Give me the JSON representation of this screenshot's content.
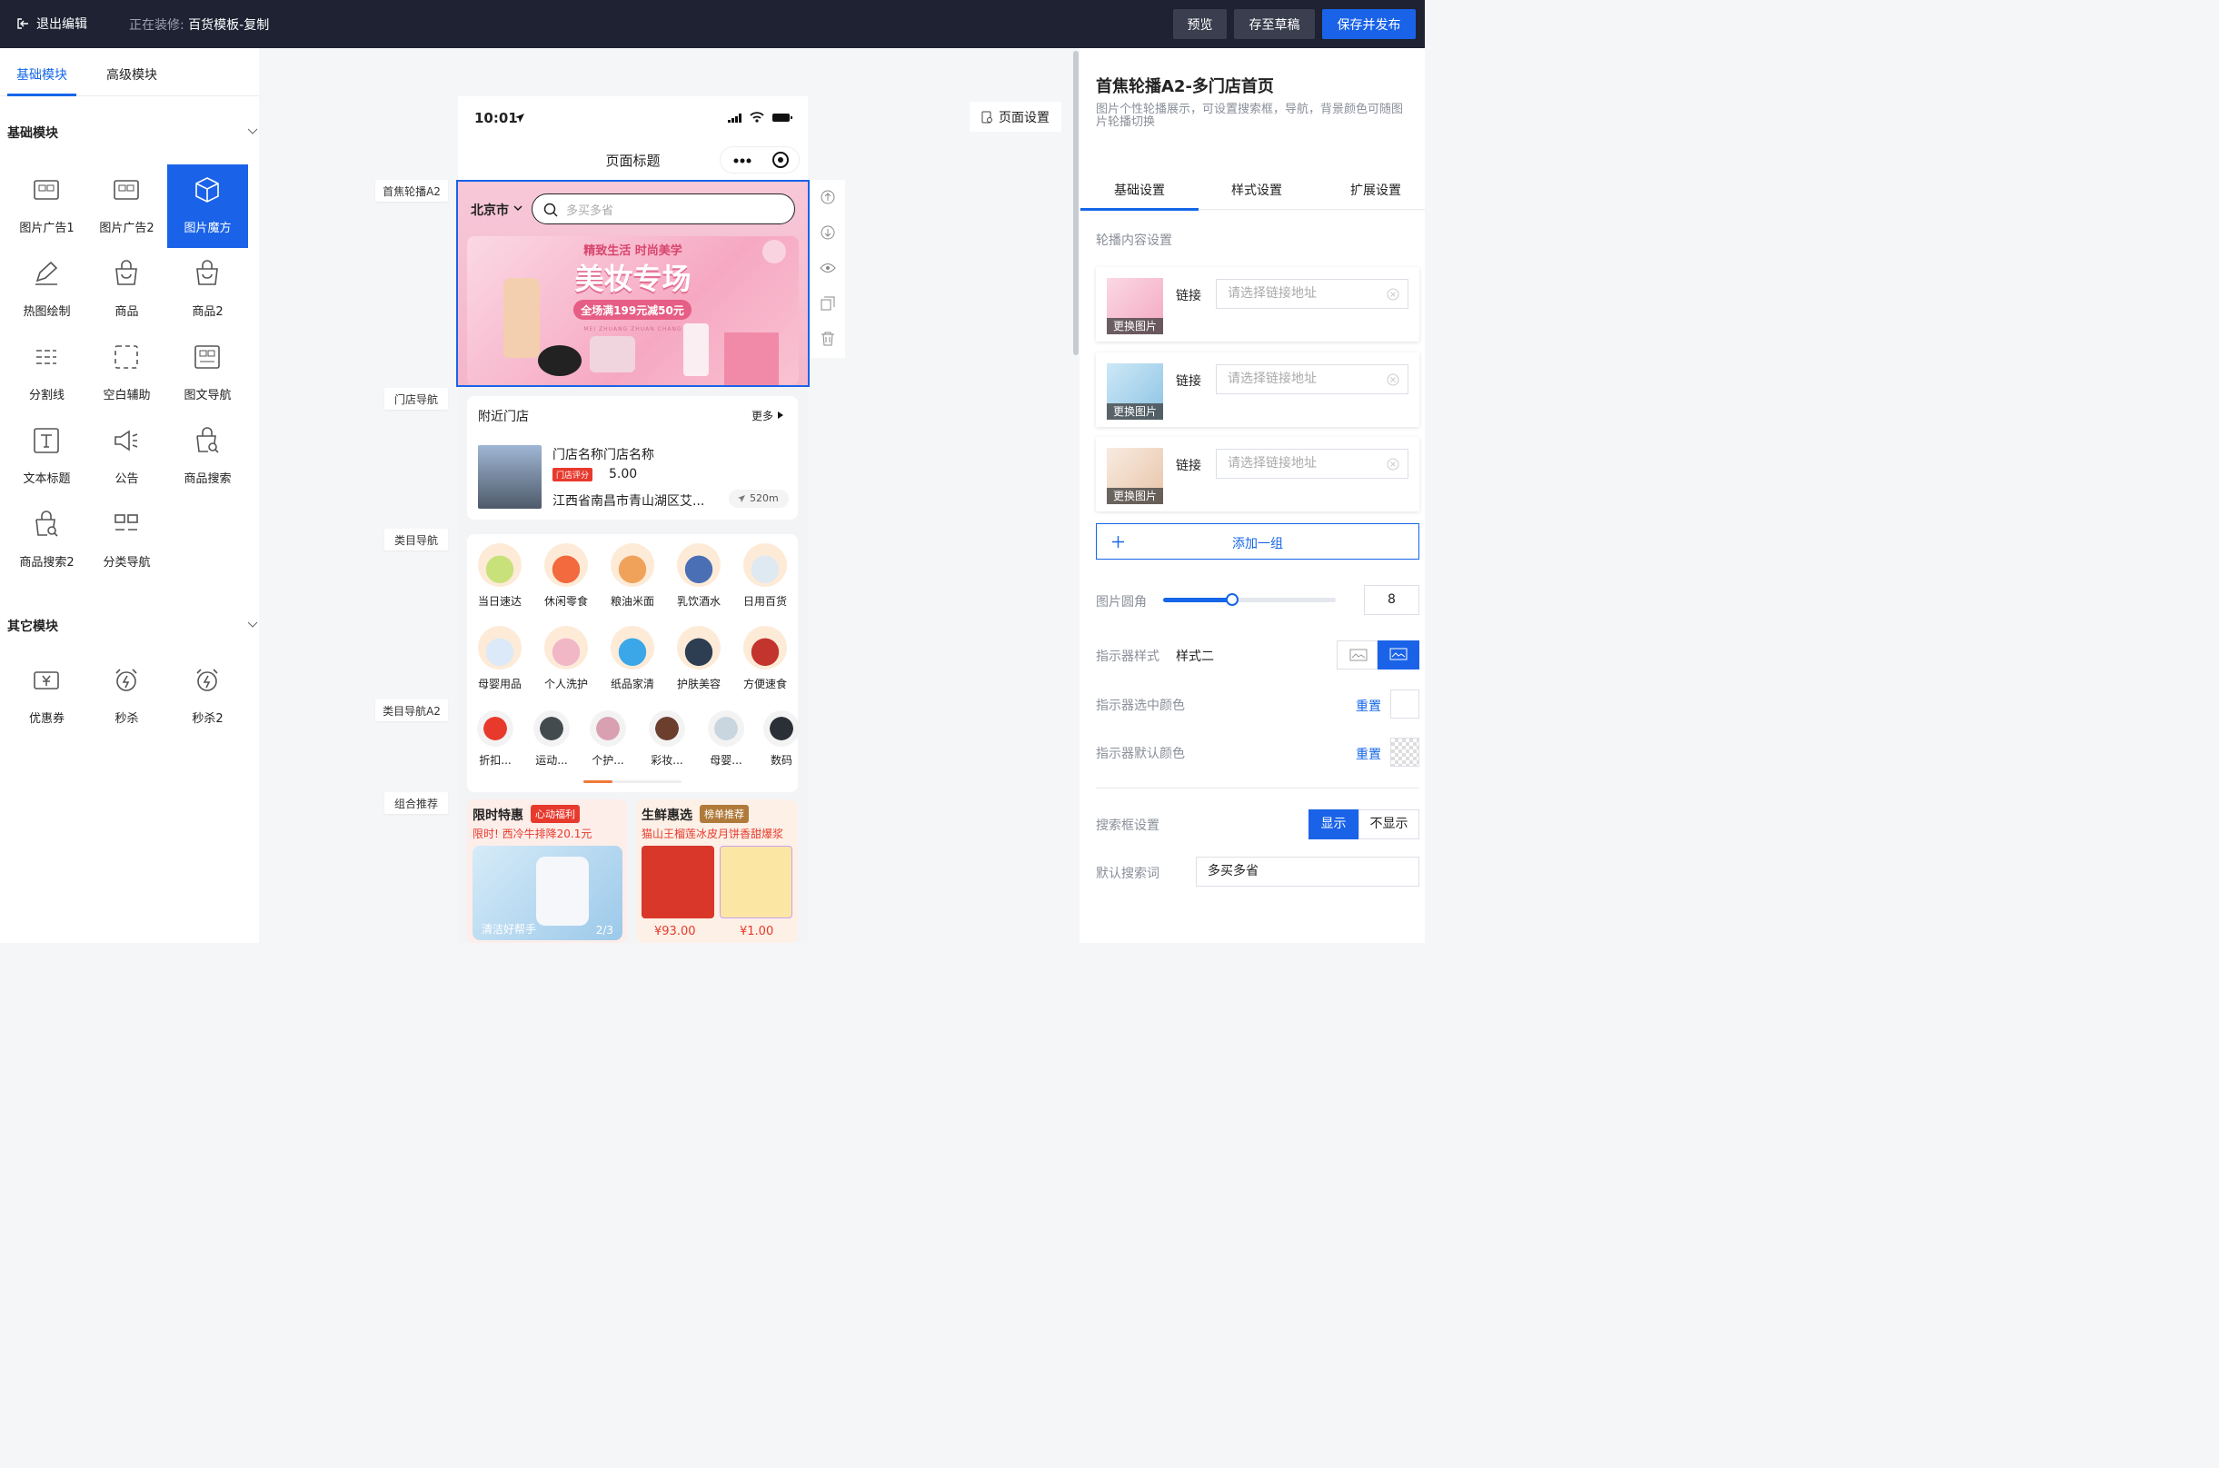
{
  "topbar": {
    "exit": "退出编辑",
    "editing_label": "正在装修:",
    "template_name": "百货模板-复制",
    "preview": "预览",
    "save_draft": "存至草稿",
    "save_publish": "保存并发布"
  },
  "left": {
    "tabs": [
      "基础模块",
      "高级模块"
    ],
    "basic_title": "基础模块",
    "other_title": "其它模块",
    "modules": [
      "图片广告1",
      "图片广告2",
      "图片魔方",
      "热图绘制",
      "商品",
      "商品2",
      "分割线",
      "空白辅助",
      "图文导航",
      "文本标题",
      "公告",
      "商品搜索",
      "商品搜索2",
      "分类导航"
    ],
    "other_modules": [
      "优惠券",
      "秒杀",
      "秒杀2"
    ]
  },
  "canvas": {
    "labels": [
      "首焦轮播A2",
      "门店导航",
      "类目导航",
      "类目导航A2",
      "组合推荐"
    ],
    "page_settings": "页面设置"
  },
  "phone": {
    "time": "10:01",
    "title": "页面标题",
    "city": "北京市",
    "search_placeholder": "多买多省",
    "banner": {
      "line1": "精致生活 时尚美学",
      "line2": "美妆专场",
      "line3": "全场满199元减50元",
      "line4": "MEI ZHUANG ZHUAN CHANG"
    },
    "store": {
      "title": "附近门店",
      "more": "更多",
      "name": "门店名称门店名称",
      "rating_label": "门店评分",
      "rating": "5.00",
      "address": "江西省南昌市青山湖区艾...",
      "distance": "520m"
    },
    "categories": [
      "当日速达",
      "休闲零食",
      "粮油米面",
      "乳饮酒水",
      "日用百货",
      "母婴用品",
      "个人洗护",
      "纸品家清",
      "护肤美容",
      "方便速食"
    ],
    "categories2": [
      "折扣...",
      "运动...",
      "个护...",
      "彩妆...",
      "母婴...",
      "数码"
    ],
    "combo": {
      "left_title": "限时特惠",
      "left_tag": "心动福利",
      "left_sub": "限时! 西冷牛排降20.1元",
      "left_img_text": "清洁好帮手",
      "left_page": "2/3",
      "right_title": "生鲜惠选",
      "right_tag": "榜单推荐",
      "right_sub": "猫山王榴莲冰皮月饼香甜爆浆",
      "price1": "¥93.00",
      "price2": "¥1.00"
    }
  },
  "right": {
    "title": "首焦轮播A2-多门店首页",
    "desc": "图片个性轮播展示，可设置搜索框，导航，背景颜色可随图片轮播切换",
    "tabs": [
      "基础设置",
      "样式设置",
      "扩展设置"
    ],
    "content_title": "轮播内容设置",
    "change_image": "更换图片",
    "link_label": "链接",
    "link_placeholder": "请选择链接地址",
    "add_group": "添加一组",
    "radius_label": "图片圆角",
    "radius_value": "8",
    "radius_fraction": 0.4,
    "indicator_style_label": "指示器样式",
    "indicator_style_value": "样式二",
    "indicator_active_color_label": "指示器选中颜色",
    "indicator_default_color_label": "指示器默认颜色",
    "reset": "重置",
    "search_settings_label": "搜索框设置",
    "show": "显示",
    "hide": "不显示",
    "default_search_label": "默认搜索词",
    "default_search_value": "多买多省"
  },
  "colors": {
    "primary": "#1566e8",
    "topbar": "#1e2233",
    "accent_red": "#e8392d"
  }
}
